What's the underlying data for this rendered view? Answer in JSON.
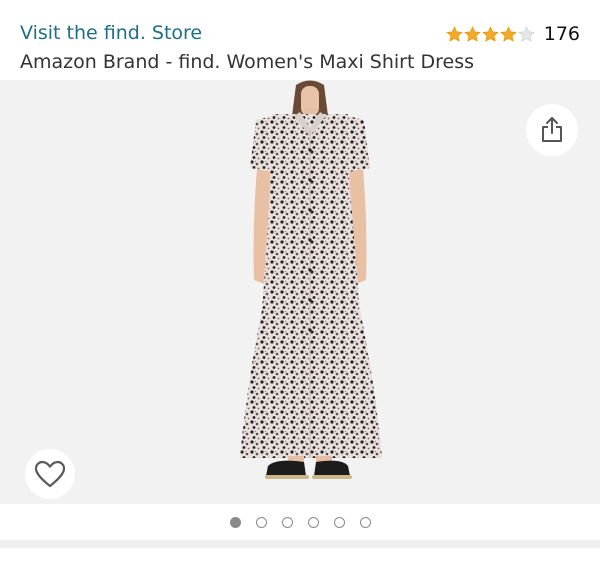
{
  "header": {
    "store_link": "Visit the find. Store",
    "rating_count": "176",
    "rating_value": 4,
    "rating_max": 5,
    "product_title": "Amazon Brand - find. Women's Maxi Shirt Dress"
  },
  "gallery": {
    "image_count": 6,
    "active_index": 0,
    "share_icon": "share-icon",
    "wishlist_icon": "heart-icon"
  },
  "colors": {
    "link": "#1b6f86",
    "star_filled": "#f4a927",
    "star_empty": "#dddddd",
    "image_bg": "#f2f2f2"
  }
}
